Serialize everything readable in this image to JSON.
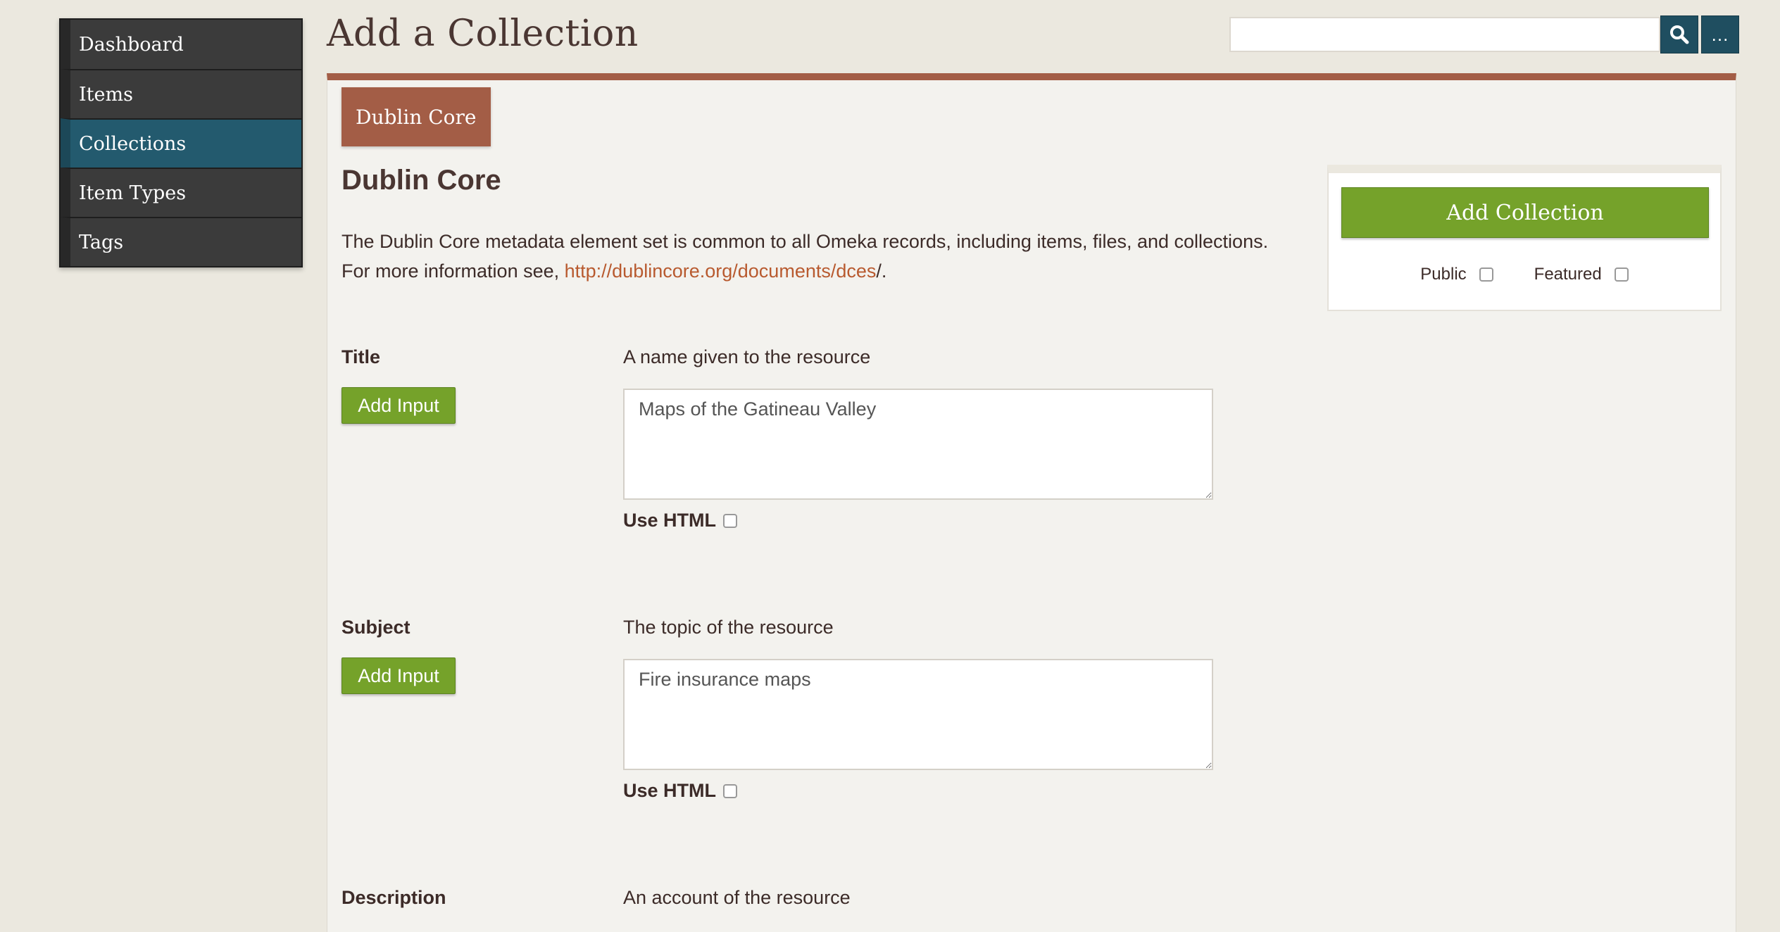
{
  "sidebar": {
    "items": [
      {
        "label": "Dashboard"
      },
      {
        "label": "Items"
      },
      {
        "label": "Collections"
      },
      {
        "label": "Item Types"
      },
      {
        "label": "Tags"
      }
    ],
    "active": "Collections"
  },
  "header": {
    "title": "Add a Collection",
    "search_value": "",
    "more_label": "..."
  },
  "tab": {
    "label": "Dublin Core"
  },
  "section": {
    "title": "Dublin Core",
    "description_prefix": "The Dublin Core metadata element set is common to all Omeka records, including items, files, and collections. For more information see, ",
    "link": "http://dublincore.org/documents/dces",
    "description_suffix": "/."
  },
  "fields": {
    "title": {
      "label": "Title",
      "hint": "A name given to the resource",
      "add_input": "Add Input",
      "value": "Maps of the Gatineau Valley",
      "use_html": "Use HTML"
    },
    "subject": {
      "label": "Subject",
      "hint": "The topic of the resource",
      "add_input": "Add Input",
      "value": "Fire insurance maps",
      "use_html": "Use HTML"
    },
    "description": {
      "label": "Description",
      "hint": "An account of the resource"
    }
  },
  "save_panel": {
    "button": "Add Collection",
    "public_label": "Public",
    "featured_label": "Featured"
  },
  "colors": {
    "accent": "#a35d46",
    "nav_active": "#235a6e",
    "button_green": "#75a22a",
    "link": "#b85a2f"
  }
}
